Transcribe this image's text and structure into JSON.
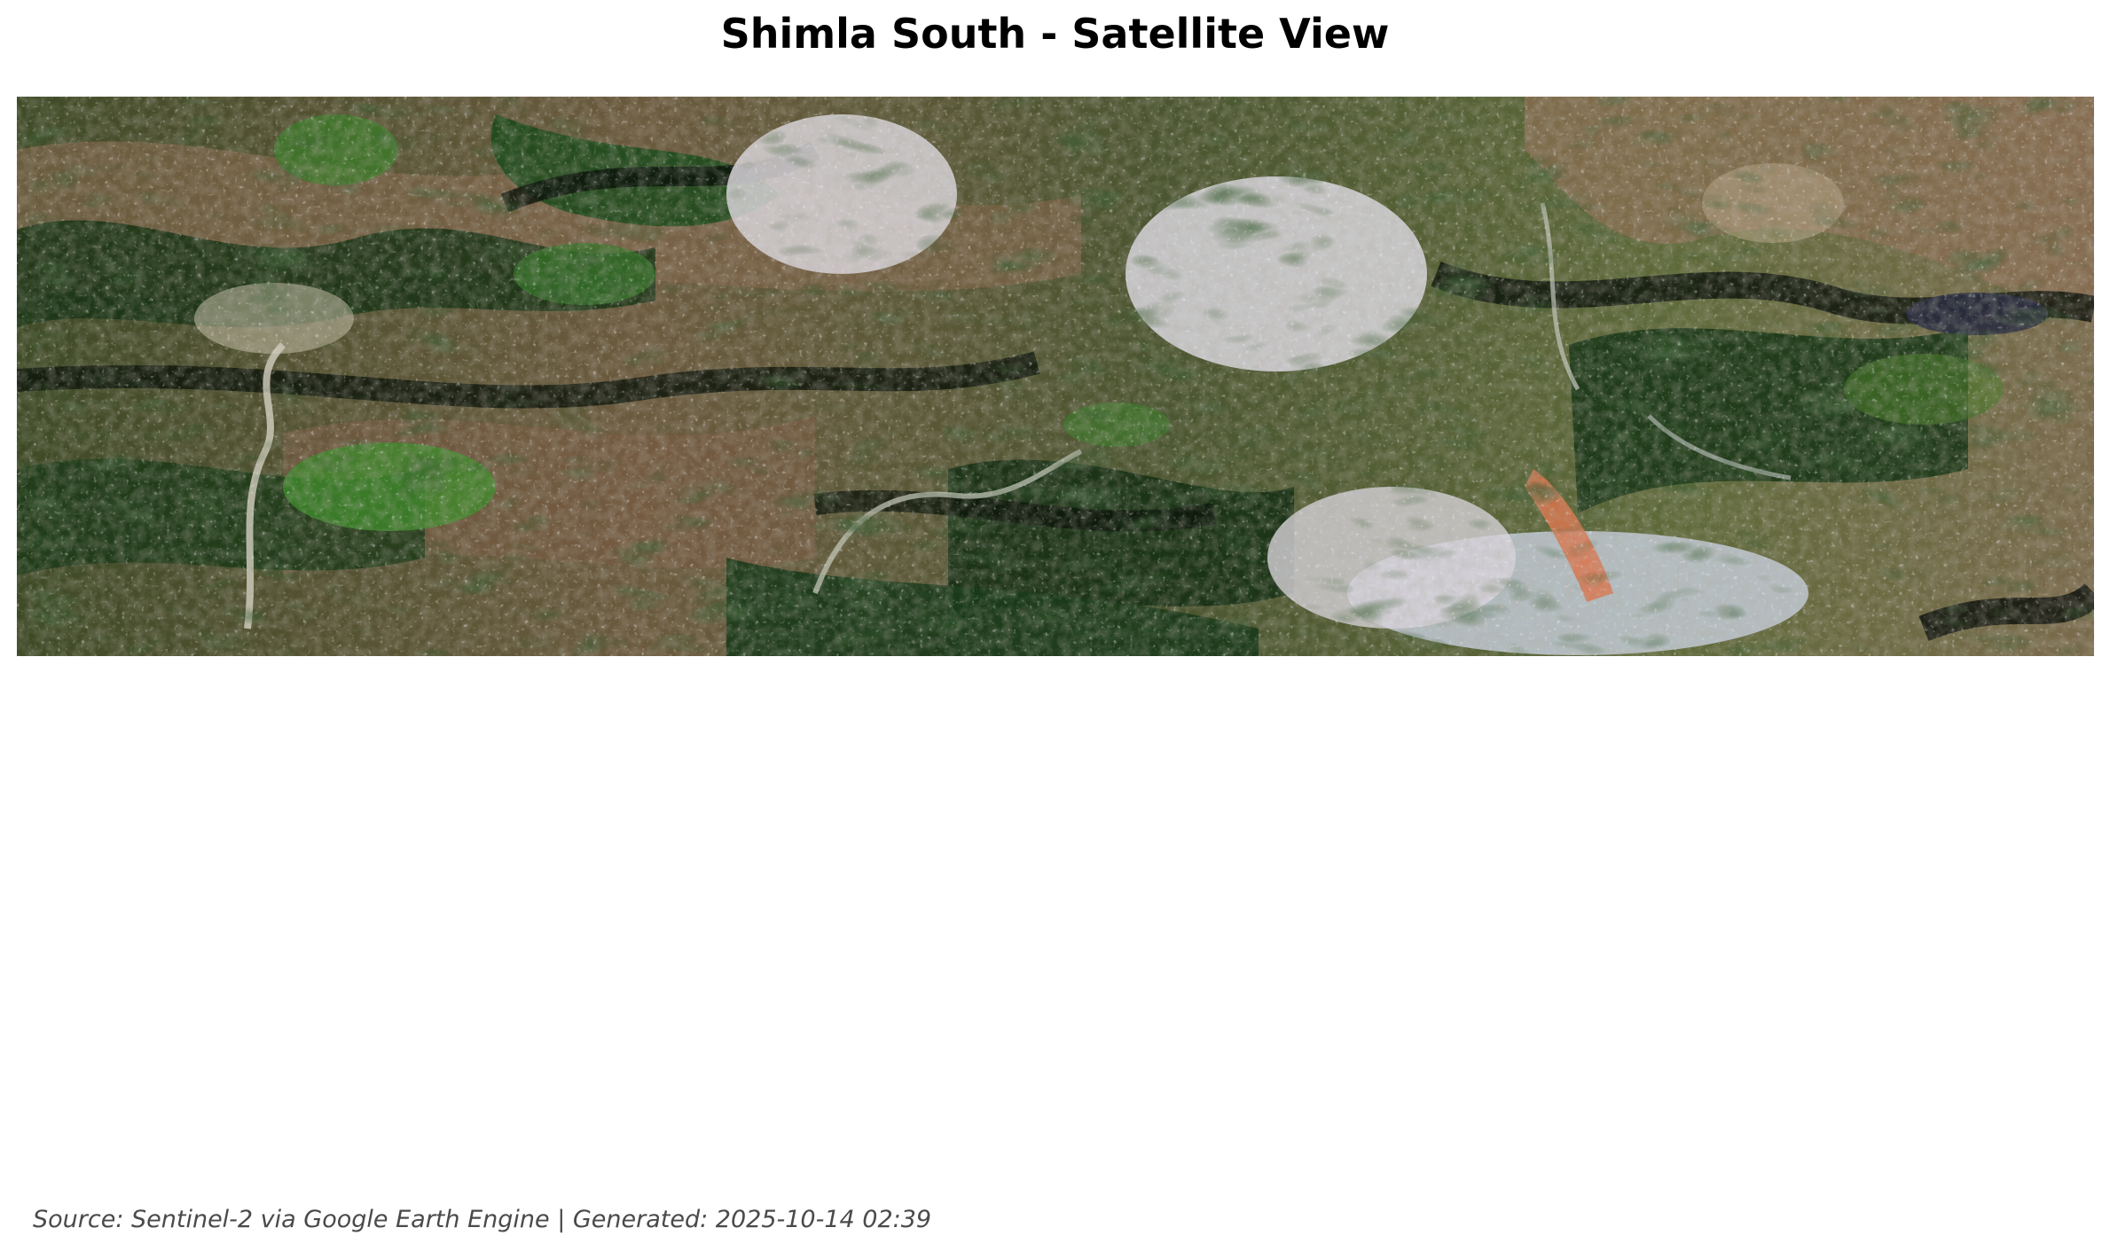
{
  "title": "Shimla South - Satellite View",
  "footer": "Source: Sentinel-2 via Google Earth Engine | Generated: 2025-10-14 02:39",
  "map": {
    "imagery": "satellite-true-color"
  }
}
